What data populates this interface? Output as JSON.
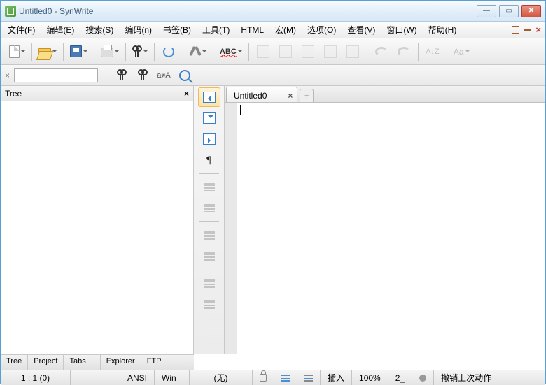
{
  "title": "Untitled0 - SynWrite",
  "menu": {
    "file": "文件(F)",
    "edit": "编辑(E)",
    "search": "搜索(S)",
    "encoding": "编码(n)",
    "bookmark": "书签(B)",
    "tool": "工具(T)",
    "html": "HTML",
    "macro": "宏(M)",
    "option": "选项(O)",
    "view": "查看(V)",
    "window": "窗口(W)",
    "help": "帮助(H)"
  },
  "abc_label": "ABC",
  "search_aA": "a≠A",
  "tree": {
    "title": "Tree",
    "tabs": [
      "Tree",
      "Project",
      "Tabs",
      "Explorer",
      "FTP"
    ]
  },
  "doc_tab": "Untitled0",
  "status": {
    "pos": "1 : 1 (0)",
    "enc": "ANSI",
    "eol": "Win",
    "lang": "(无)",
    "mode": "插入",
    "zoom": "100%",
    "char": "2_",
    "undo": "撤销上次动作"
  },
  "sort_label": "A↓Z",
  "aa_label": "Aa"
}
